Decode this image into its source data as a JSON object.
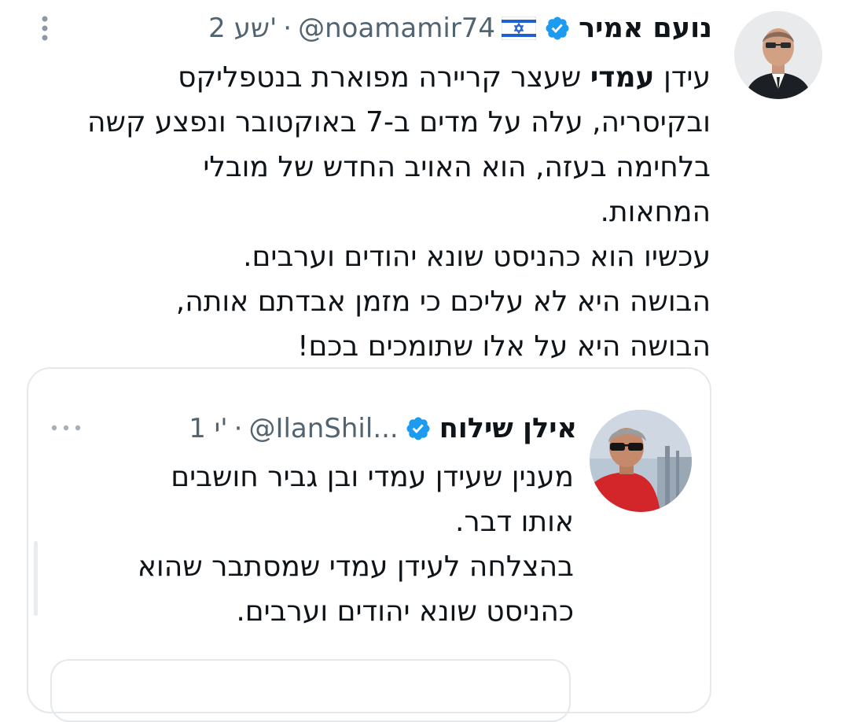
{
  "tweet": {
    "display_name": "נועם אמיר",
    "handle": "@noamamir74",
    "separator": "·",
    "time": "2 שע'",
    "flag_icon": "israel-flag-icon",
    "text_bold": "עמדי",
    "text_line1_prefix": "עידן ",
    "text_line1_suffix": " שעצר קריירה מפוארת בנטפליקס",
    "text_rest": "ובקיסריה, עלה על מדים ב-7 באוקטובר ונפצע קשה\nבלחימה בעזה, הוא האויב החדש של מובלי\nהמחאות.\nעכשיו הוא כהניסט שונא יהודים וערבים.\nהבושה היא לא עליכם כי מזמן אבדתם אותה,\nהבושה היא על אלו שתומכים בכם!"
  },
  "quoted_tweet": {
    "display_name": "אילן שילוח",
    "handle": "@IlanShil...",
    "separator": "·",
    "time": "1 י'",
    "text": "מענין שעידן עמדי ובן גביר חושבים\nאותו דבר.\nבהצלחה לעידן עמדי שמסתבר שהוא\nכהניסט שונא יהודים וערבים."
  },
  "colors": {
    "text_primary": "#0f1419",
    "text_secondary": "#536471",
    "verified_blue": "#1d9bf0",
    "border": "#e5e9ec"
  }
}
